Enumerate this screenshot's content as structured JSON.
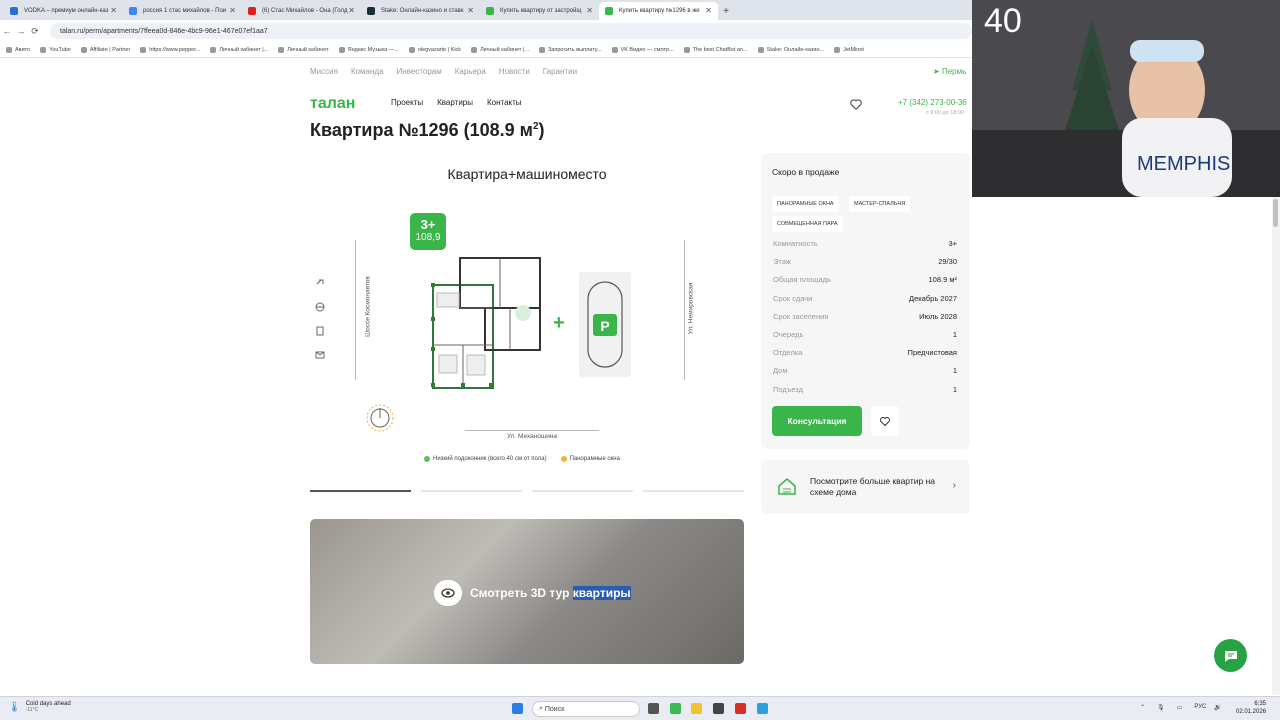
{
  "browser": {
    "tabs": [
      {
        "title": "VODKA – премиум онлайн-каз",
        "favicon_color": "#2b6fd6"
      },
      {
        "title": "россия 1 стас михайлов - Пои",
        "favicon_color": "#4285f4"
      },
      {
        "title": "(6) Стас Михайлов - Она (Голд",
        "favicon_color": "#e02020"
      },
      {
        "title": "Stake: Онлайн-казино и ставк",
        "favicon_color": "#1a2c38"
      },
      {
        "title": "Купить квартиру от застройщ",
        "favicon_color": "#39b54a"
      },
      {
        "title": "Купить квартиру №1296 в жи",
        "favicon_color": "#39b54a"
      }
    ],
    "new_tab": "+",
    "url": "talan.ru/perm/apartments/7ffeea0d-846e-4bc9-96e1-467e07ef1aa7",
    "bookmarks": [
      "Авито",
      "YouTube",
      "Affiliate | Partner",
      "https://www.pepper...",
      "Личный кабинет |...",
      "Личный кабинет",
      "Яндекс Музыка —...",
      "olegvazarte | Kick",
      "Личный кабинет |...",
      "Запросить выплату...",
      "VK Видео — смотр...",
      "The best ChatBot an...",
      "Stake: Онлайн-казин...",
      "JetMinet"
    ]
  },
  "webcam": {
    "counter": "40"
  },
  "site": {
    "top_links": [
      "Миссия",
      "Команда",
      "Инвесторам",
      "Карьера",
      "Новости",
      "Гарантии"
    ],
    "city": "Пермь",
    "logo": "талан",
    "main_nav": [
      "Проекты",
      "Квартиры",
      "Контакты"
    ],
    "phone": "+7 (342) 273-00-36",
    "phone_hours": "с 9:00 до 18:00"
  },
  "apartment": {
    "title_main": "Квартира №1296 (108.9 м",
    "title_sup": "2",
    "title_end": ")",
    "plan_title": "Квартира+машиноместо",
    "badge_rooms": "3+",
    "badge_area": "108,9",
    "road_left": "Шоссе Космонавтов",
    "road_right": "Ул. Немировская",
    "road_bottom": "Ул. Механошина",
    "parking_label": "P",
    "legend": [
      {
        "label": "Низкий подоконник (всего 40 см от пола)",
        "color": "#5cc25c"
      },
      {
        "label": "Панорамные окна",
        "color": "#f2b33d"
      }
    ],
    "tour_label": "Смотреть 3D тур ",
    "tour_highlight": "квартиры"
  },
  "sidebar": {
    "status": "Скоро в продаже",
    "tags": [
      "ПАНОРАМНЫЕ ОКНА",
      "МАСТЕР-СПАЛЬНЯ",
      "СОВМЕЩЕННАЯ ПАРА"
    ],
    "props": [
      {
        "k": "Комнатность",
        "v": "3+"
      },
      {
        "k": "Этаж",
        "v": "29/30"
      },
      {
        "k": "Общая площадь",
        "v": "108.9 м²"
      },
      {
        "k": "Срок сдачи",
        "v": "Декабрь 2027"
      },
      {
        "k": "Срок заселения",
        "v": "Июль 2028"
      },
      {
        "k": "Очередь",
        "v": "1"
      },
      {
        "k": "Отделка",
        "v": "Предчистовая"
      },
      {
        "k": "Дом",
        "v": "1"
      },
      {
        "k": "Подъезд",
        "v": "1"
      }
    ],
    "consult_button": "Консультация",
    "scheme_link": "Посмотрите больше квартир на схеме дома"
  },
  "taskbar": {
    "weather_title": "Cold days ahead",
    "weather_temp": "-11°C",
    "search_placeholder": "Поиск",
    "lang": "РУС",
    "time": "6:35",
    "date": "02.01.2026"
  }
}
